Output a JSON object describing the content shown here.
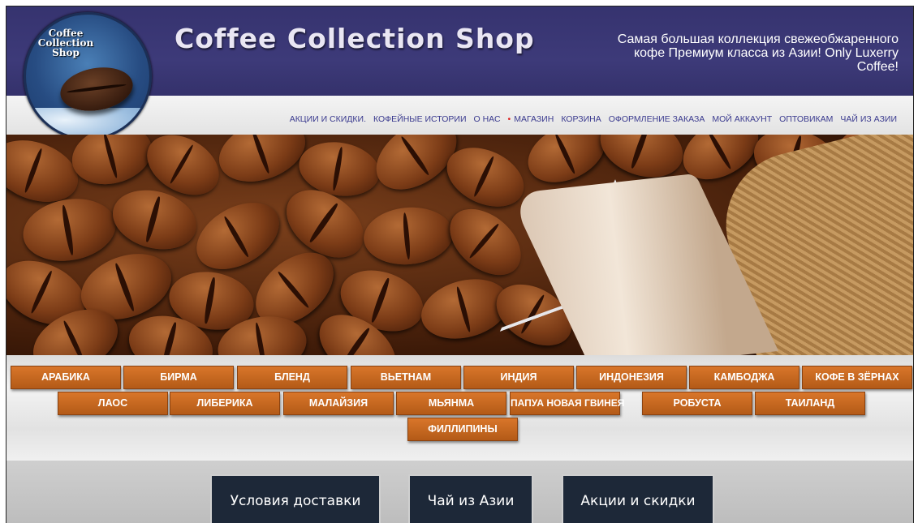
{
  "header": {
    "site_title": "Coffee Collection Shop",
    "tagline_line1": "Самая большая коллекция свежеобжаренного",
    "tagline_line2": "кофе Премиум класса из Азии! Only Luxerry",
    "tagline_line3": "Coffee!",
    "logo_line1": "Coffee",
    "logo_line2": "Collection",
    "logo_line3": "Shop"
  },
  "nav": {
    "items": [
      "АКЦИИ И СКИДКИ.",
      "КОФЕЙНЫЕ ИСТОРИИ",
      "О НАС",
      "МАГАЗИН",
      "КОРЗИНА",
      "ОФОРМЛЕНИЕ ЗАКАЗА",
      "МОЙ АККАУНТ",
      "ОПТОВИКАМ",
      "ЧАЙ ИЗ АЗИИ"
    ],
    "bullet": "•"
  },
  "categories": {
    "row1": [
      "АРАБИКА",
      "БИРМА",
      "БЛЕНД",
      "ВЬЕТНАМ",
      "ИНДИЯ",
      "ИНДОНЕЗИЯ",
      "КАМБОДЖА",
      "КОФЕ В ЗЁРНАХ"
    ],
    "row2": [
      "ЛАОС",
      "ЛИБЕРИКА",
      "МАЛАЙЗИЯ",
      "МЬЯНМА",
      "ПАПУА НОВАЯ ГВИНЕЯ",
      "РОБУСТА",
      "ТАИЛАНД"
    ],
    "row3": [
      "ФИЛЛИПИНЫ"
    ]
  },
  "buttons": {
    "delivery": "Условия доставки",
    "tea": "Чай из Азии",
    "sales": "Акции и скидки"
  },
  "colors": {
    "header_bg": "#3d3a79",
    "nav_text": "#3b3b8f",
    "category_bg": "#c8681f",
    "button_bg": "#1d2838"
  }
}
